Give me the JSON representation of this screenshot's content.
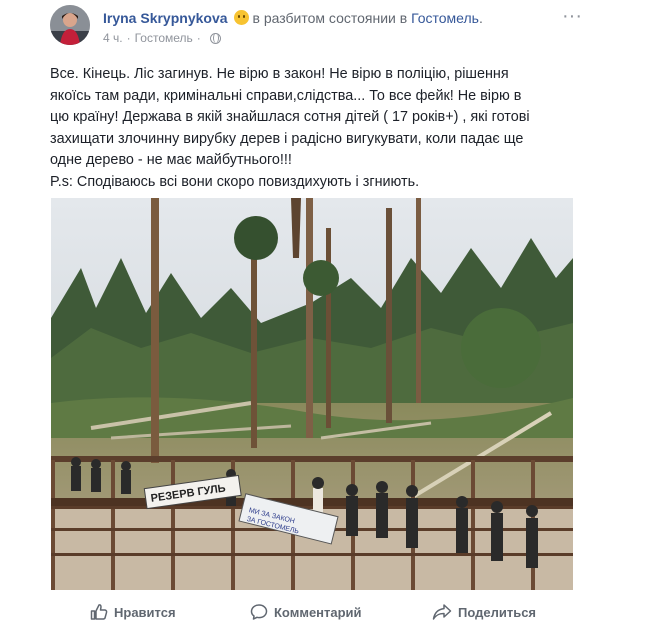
{
  "post": {
    "author": "Iryna Skrypnykova",
    "feeling": "в разбитом состоянии в",
    "location": "Гостомель",
    "time": "4 ч.",
    "meta_location": "Гостомель",
    "text_lines": [
      "Все. Кінець. Ліс загинув. Не вірю в закон! Не вірю в поліцію, рішення",
      "якоїсь там ради, кримінальні справи,слідства... То все фейк! Не вірю в",
      "цю країну! Держава в якій знайшлася сотня дітей ( 17 років+) , які готові",
      "захищати злочинну вирубку дерев і радісно вигукувати, коли падає ще",
      "одне дерево - не має майбутнього!!!",
      "P.s: Сподіваюсь всі вони скоро повиздихують і згниють."
    ]
  },
  "photo": {
    "banner_left": "РЕЗЕРВ ГУЛЬ",
    "banner_right": "МИ ЗА ЗАКОН\nЗА ГОСТОМЕЛЬ"
  },
  "actions": {
    "like": "Нравится",
    "comment": "Комментарий",
    "share": "Поделиться"
  },
  "colors": {
    "link": "#365899",
    "meta": "#90949c",
    "action": "#606770"
  },
  "icons": [
    "more-icon",
    "globe-icon",
    "like-icon",
    "comment-icon",
    "share-icon",
    "feeling-emoji-icon"
  ]
}
